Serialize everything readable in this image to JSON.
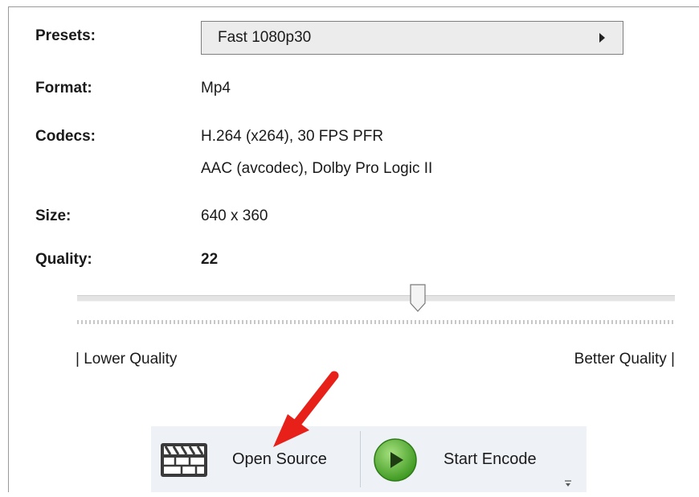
{
  "presets": {
    "label": "Presets:",
    "value": "Fast 1080p30"
  },
  "format": {
    "label": "Format:",
    "value": "Mp4"
  },
  "codecs": {
    "label": "Codecs:",
    "video": "H.264 (x264), 30 FPS PFR",
    "audio": "AAC (avcodec), Dolby Pro Logic II"
  },
  "size": {
    "label": "Size:",
    "value": "640 x 360"
  },
  "quality": {
    "label": "Quality:",
    "value": "22",
    "slider_fraction": 0.57,
    "lower_label": "| Lower Quality",
    "better_label": "Better Quality |"
  },
  "toolbar": {
    "open_source_label": "Open Source",
    "start_encode_label": "Start Encode",
    "more_icon": "chevron-down-small-icon"
  },
  "annotation": {
    "arrow_color": "#e8201a"
  },
  "colors": {
    "play_green": "#5fb93a",
    "toolbar_bg": "#eef1f5"
  }
}
